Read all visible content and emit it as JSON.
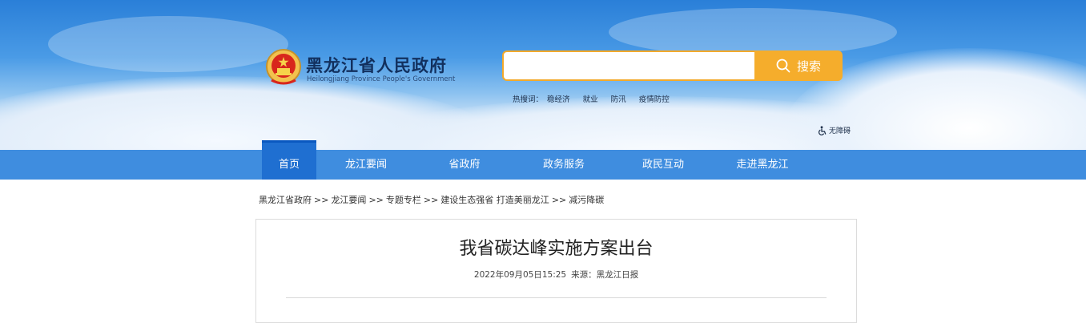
{
  "header": {
    "title": "黑龙江省人民政府",
    "subtitle": "Heilongjiang Province People's Government"
  },
  "search": {
    "placeholder": "",
    "button_label": "搜索"
  },
  "hotwords": {
    "label": "热搜词：",
    "items": [
      "稳经济",
      "就业",
      "防汛",
      "疫情防控"
    ]
  },
  "accessibility": {
    "label": "无障碍"
  },
  "nav": {
    "items": [
      {
        "label": "首页",
        "active": true
      },
      {
        "label": "龙江要闻",
        "active": false
      },
      {
        "label": "省政府",
        "active": false
      },
      {
        "label": "政务服务",
        "active": false
      },
      {
        "label": "政民互动",
        "active": false
      },
      {
        "label": "走进黑龙江",
        "active": false
      }
    ]
  },
  "breadcrumb": {
    "items": [
      "黑龙江省政府",
      "龙江要闻",
      "专题专栏",
      "建设生态强省 打造美丽龙江",
      "减污降碳"
    ],
    "separator": ">>"
  },
  "article": {
    "title": "我省碳达峰实施方案出台",
    "datetime": "2022年09月05日15:25",
    "source_label": "来源：",
    "source": "黑龙江日报"
  },
  "colors": {
    "nav_bg": "#3f8ddf",
    "nav_active": "#1f6fd1",
    "search_accent": "#f5ad2c",
    "title_color": "#12305e"
  }
}
